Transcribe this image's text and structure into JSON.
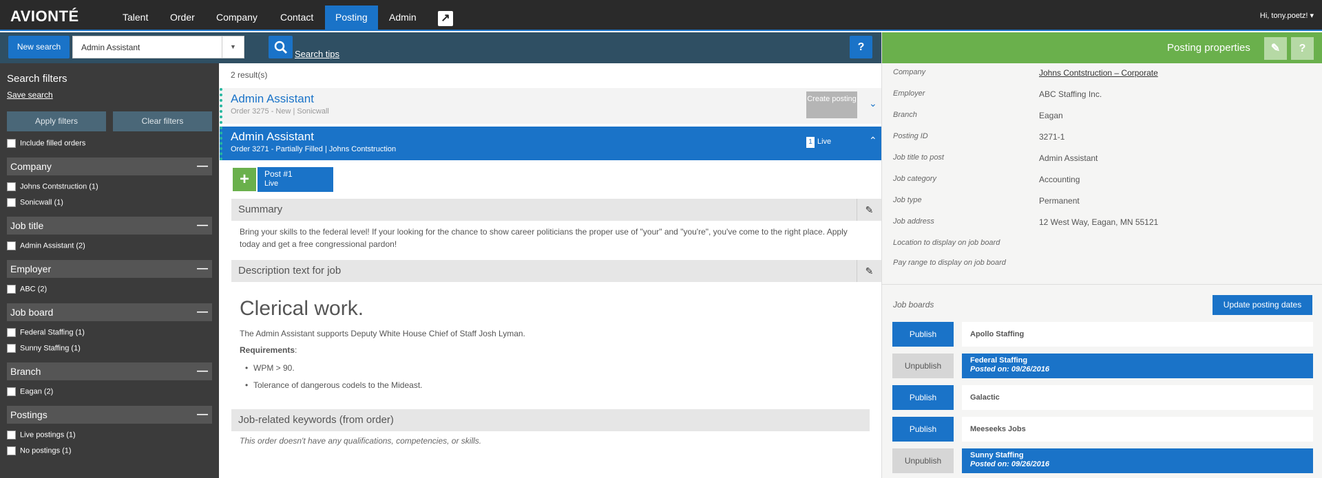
{
  "app": {
    "logo": "AVIONTÉ",
    "user": "Hi, tony.poetz! ▾"
  },
  "nav": [
    {
      "label": "Talent"
    },
    {
      "label": "Order"
    },
    {
      "label": "Company"
    },
    {
      "label": "Contact"
    },
    {
      "label": "Posting",
      "active": true
    },
    {
      "label": "Admin"
    }
  ],
  "search": {
    "new_search_label": "New search",
    "value": "Admin Assistant",
    "tips_label": "Search tips",
    "help_label": "?"
  },
  "sidebar": {
    "title": "Search filters",
    "save_search": "Save search",
    "apply_label": "Apply filters",
    "clear_label": "Clear filters",
    "include_filled": "Include filled orders",
    "groups": [
      {
        "title": "Company",
        "items": [
          "Johns Contstruction (1)",
          "Sonicwall (1)"
        ]
      },
      {
        "title": "Job title",
        "items": [
          "Admin Assistant (2)"
        ]
      },
      {
        "title": "Employer",
        "items": [
          "ABC (2)"
        ]
      },
      {
        "title": "Job board",
        "items": [
          "Federal Staffing (1)",
          "Sunny Staffing (1)"
        ]
      },
      {
        "title": "Branch",
        "items": [
          "Eagan (2)"
        ]
      },
      {
        "title": "Postings",
        "items": [
          "Live postings (1)",
          "No postings (1)"
        ]
      }
    ]
  },
  "results": {
    "count": "2 result(s)",
    "items": [
      {
        "title": "Admin Assistant",
        "subtitle": "Order 3275 - New | Sonicwall",
        "action": "Create posting",
        "chevron": "⌄"
      },
      {
        "title": "Admin Assistant",
        "subtitle": "Order 3271 - Partially Filled | Johns Contstruction",
        "badge": "1",
        "status": "Live",
        "chevron": "⌃"
      }
    ]
  },
  "posting": {
    "add_icon": "+",
    "post_label": "Post #1",
    "post_status": "Live",
    "summary_header": "Summary",
    "summary_text": "Bring your skills to the federal level! If your looking for the chance to show career politicians the proper use of \"your\" and \"you're\", you've come to the right place. Apply today and get a free congressional pardon!",
    "description_header": "Description text for job",
    "description_heading": "Clerical work.",
    "description_text": "The Admin Assistant supports Deputy White House Chief of Staff Josh Lyman.",
    "requirements_label": "Requirements",
    "requirements": [
      "WPM > 90.",
      "Tolerance of dangerous codels to the Mideast."
    ],
    "keywords_header": "Job-related keywords (from order)",
    "keywords_text": "This order doesn't have any qualifications, competencies, or skills."
  },
  "properties": {
    "title": "Posting properties",
    "rows": [
      {
        "label": "Company",
        "value": "Johns Contstruction – Corporate",
        "link": true
      },
      {
        "label": "Employer",
        "value": "ABC Staffing Inc."
      },
      {
        "label": "Branch",
        "value": "Eagan"
      },
      {
        "label": "Posting ID",
        "value": "3271-1"
      },
      {
        "label": "Job title to post",
        "value": "Admin Assistant"
      },
      {
        "label": "Job category",
        "value": "Accounting"
      },
      {
        "label": "Job type",
        "value": "Permanent"
      },
      {
        "label": "Job address",
        "value": "12 West Way, Eagan, MN 55121"
      },
      {
        "label": "Location to display on job board",
        "value": ""
      },
      {
        "label": "Pay range to display on job board",
        "value": ""
      }
    ],
    "job_boards_label": "Job boards",
    "update_label": "Update posting dates",
    "boards": [
      {
        "action": "Publish",
        "name": "Apollo Staffing",
        "posted": ""
      },
      {
        "action": "Unpublish",
        "name": "Federal Staffing",
        "posted": "Posted on: 09/26/2016"
      },
      {
        "action": "Publish",
        "name": "Galactic",
        "posted": ""
      },
      {
        "action": "Publish",
        "name": "Meeseeks Jobs",
        "posted": ""
      },
      {
        "action": "Unpublish",
        "name": "Sunny Staffing",
        "posted": "Posted on: 09/26/2016"
      }
    ]
  },
  "colors": {
    "accent": "#1a73c8",
    "green": "#6ab04c",
    "navbar": "#2a2a2a",
    "sidebar": "#3b3b3b"
  }
}
